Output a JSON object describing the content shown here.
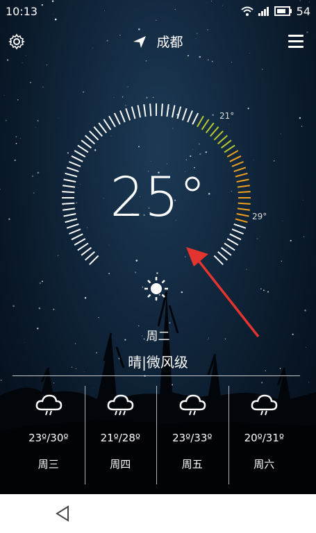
{
  "status": {
    "time": "10:13",
    "battery": "54"
  },
  "header": {
    "city": "成都"
  },
  "current": {
    "temp": "25°",
    "low_tag": "21°",
    "high_tag": "29°",
    "day": "周二",
    "condition": "晴|微风级"
  },
  "forecast": [
    {
      "icon": "cloud-rain-icon",
      "range": "23º/30º",
      "day": "周三"
    },
    {
      "icon": "cloud-rain-icon",
      "range": "21º/28º",
      "day": "周四"
    },
    {
      "icon": "cloud-rain-icon",
      "range": "23º/33º",
      "day": "周五"
    },
    {
      "icon": "cloud-rain-icon",
      "range": "20º/31º",
      "day": "周六"
    }
  ],
  "colors": {
    "accent_low": "#b9c92f",
    "accent_high": "#f0a01e",
    "arrow": "#e3342f"
  }
}
